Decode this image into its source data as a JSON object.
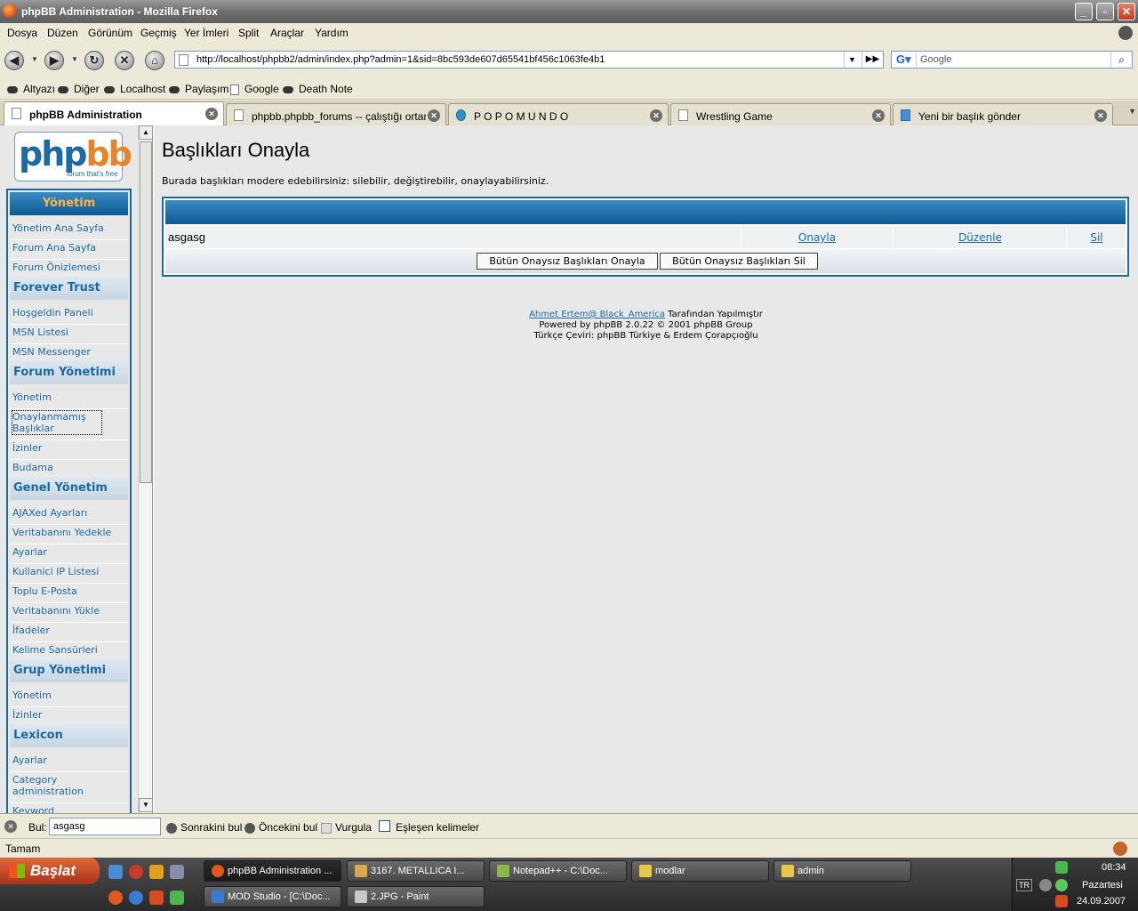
{
  "window": {
    "title": "phpBB Administration - Mozilla Firefox"
  },
  "menu": [
    "Dosya",
    "Düzen",
    "Görünüm",
    "Geçmiş",
    "Yer İmleri",
    "Split",
    "Araçlar",
    "Yardım"
  ],
  "address": {
    "url": "http://localhost/phpbb2/admin/index.php?admin=1&sid=8bc593de607d65541bf456c1063fe4b1"
  },
  "search": {
    "engine_icon": "google-icon",
    "placeholder": "Google"
  },
  "bookmarks": [
    "Altyazı",
    "Diğer",
    "Localhost",
    "Paylaşım",
    "Google",
    "Death Note"
  ],
  "tabs": [
    {
      "label": "phpBB Administration"
    },
    {
      "label": "phpbb.phpbb_forums -- çalıştığı ortam --]..."
    },
    {
      "label": "P O P O M U N D O"
    },
    {
      "label": "Wrestling Game"
    },
    {
      "label": "Yeni bir başlık gönder"
    }
  ],
  "logo": {
    "text1": "php",
    "text2": "bb",
    "tagline": "forum that's free"
  },
  "nav": {
    "s0": {
      "title": "Yönetim",
      "links": [
        "Yönetim Ana Sayfa",
        "Forum Ana Sayfa",
        "Forum Önizlemesi"
      ]
    },
    "s1": {
      "title": "Forever Trust",
      "links": [
        "Hoşgeldin Paneli",
        "MSN Listesi",
        "MSN Messenger"
      ]
    },
    "s2": {
      "title": "Forum Yönetimi",
      "links": [
        "Yönetim",
        "Onaylanmamış Başlıklar",
        "İzinler",
        "Budama"
      ]
    },
    "s3": {
      "title": "Genel Yönetim",
      "links": [
        "AJAXed Ayarları",
        "Veritabanını Yedekle",
        "Ayarlar",
        "Kullanici IP Listesi",
        "Toplu E-Posta",
        "Veritabanını Yükle",
        "İfadeler",
        "Kelime Sansürleri"
      ]
    },
    "s4": {
      "title": "Grup Yönetimi",
      "links": [
        "Yönetim",
        "İzinler"
      ]
    },
    "s5": {
      "title": "Lexicon",
      "links": [
        "Ayarlar",
        "Category administration",
        "Keyword"
      ]
    }
  },
  "main": {
    "title": "Başlıkları Onayla",
    "description": "Burada başlıkları modere edebilirsiniz: silebilir, değiştirebilir, onaylayabilirsiniz.",
    "row": {
      "topic": "asgasg",
      "approve": "Onayla",
      "edit": "Düzenle",
      "delete": "Sil"
    },
    "approve_all": "Bütün Onaysız Başlıkları Onayla",
    "delete_all": "Bütün Onaysız Başlıkları Sil"
  },
  "credits": {
    "author_link": "Ahmet Ertem@ Black_America",
    "author_suffix": " Tarafından Yapılmıştır",
    "powered": "Powered by phpBB 2.0.22 © 2001 phpBB Group",
    "translation": "Türkçe Çeviri: phpBB Türkiye & Erdem Çorapçıoğlu"
  },
  "findbar": {
    "label": "Bul:",
    "value": "asgasg",
    "next": "Sonrakini bul",
    "prev": "Öncekini bul",
    "highlight": "Vurgula",
    "match_case": "Eşleşen kelimeler"
  },
  "status": {
    "text": "Tamam"
  },
  "taskbar": {
    "start": "Başlat",
    "tasks_top": [
      "phpBB Administration ...",
      "3167. METALLICA   I...",
      "Notepad++ - C:\\Doc...",
      "modlar",
      "admin"
    ],
    "tasks_bottom": [
      "MOD Studio - [C:\\Doc...",
      "2.JPG - Paint"
    ]
  },
  "tray": {
    "lang": "TR",
    "time": "08:34",
    "day": "Pazartesi",
    "date": "24.09.2007"
  }
}
